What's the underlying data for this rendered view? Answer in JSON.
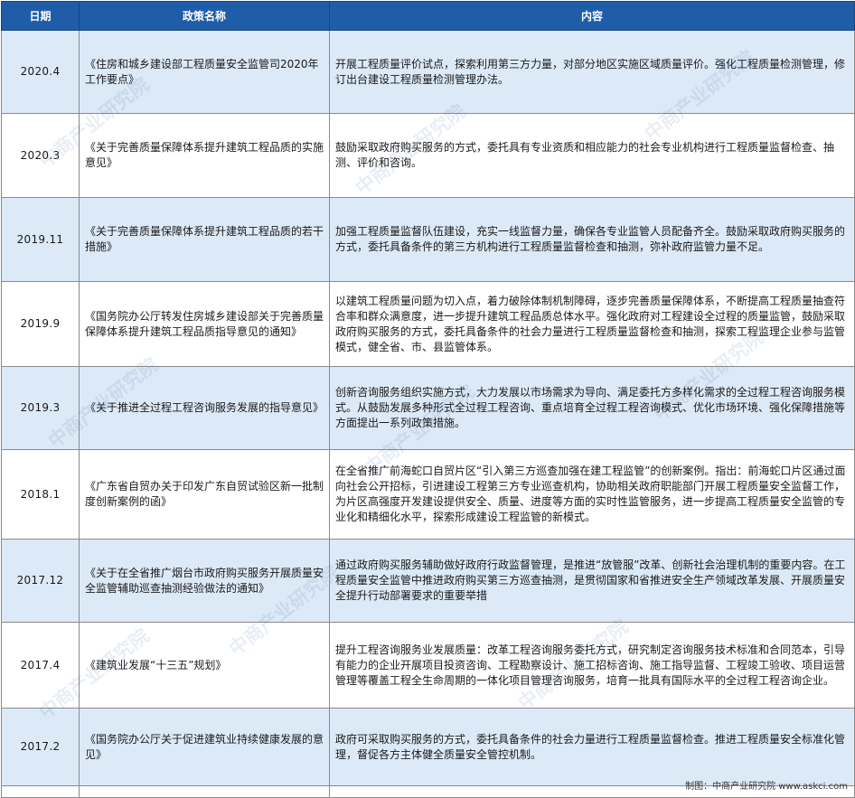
{
  "table": {
    "headers": {
      "date": "日期",
      "name": "政策名称",
      "content": "内容"
    },
    "rows": [
      {
        "date": "2020.4",
        "name": "《住房和城乡建设部工程质量安全监管司2020年工作要点》",
        "content": "开展工程质量评价试点，探索利用第三方力量，对部分地区实施区域质量评价。强化工程质量检测管理，修订出台建设工程质量检测管理办法。"
      },
      {
        "date": "2020.3",
        "name": "《关于完善质量保障体系提升建筑工程品质的实施意见》",
        "content": "鼓励采取政府购买服务的方式，委托具有专业资质和相应能力的社会专业机构进行工程质量监督检查、抽测、评价和咨询。"
      },
      {
        "date": "2019.11",
        "name": "《关于完善质量保障体系提升建筑工程品质的若干措施》",
        "content": "加强工程质量监督队伍建设，充实一线监督力量，确保各专业监管人员配备齐全。鼓励采取政府购买服务的方式，委托具备条件的第三方机构进行工程质量监督检查和抽测，弥补政府监管力量不足。"
      },
      {
        "date": "2019.9",
        "name": "《国务院办公厅转发住房城乡建设部关于完善质量保障体系提升建筑工程品质指导意见的通知》",
        "content": "以建筑工程质量问题为切入点，着力破除体制机制障碍，逐步完善质量保障体系，不断提高工程质量抽查符合率和群众满意度，进一步提升建筑工程品质总体水平。强化政府对工程建设全过程的质量监管，鼓励采取政府购买服务的方式，委托具备条件的社会力量进行工程质量监督检查和抽测，探索工程监理企业参与监管模式，健全省、市、县监管体系。"
      },
      {
        "date": "2019.3",
        "name": "《关于推进全过程工程咨询服务发展的指导意见》",
        "content": "创新咨询服务组织实施方式，大力发展以市场需求为导向、满足委托方多样化需求的全过程工程咨询服务模式。从鼓励发展多种形式全过程工程咨询、重点培育全过程工程咨询模式、优化市场环境、强化保障措施等方面提出一系列政策措施。"
      },
      {
        "date": "2018.1",
        "name": "《广东省自贸办关于印发广东自贸试验区新一批制度创新案例的函》",
        "content": "在全省推广前海蛇口自贸片区“引入第三方巡查加强在建工程监管”的创新案例。指出：前海蛇口片区通过面向社会公开招标，引进建设工程第三方专业巡查机构，协助相关政府职能部门开展工程质量安全监督工作，为片区高强度开发建设提供安全、质量、进度等方面的实时性监管服务，进一步提高工程质量安全监管的专业化和精细化水平，探索形成建设工程监管的新模式。"
      },
      {
        "date": "2017.12",
        "name": "《关于在全省推广烟台市政府购买服务开展质量安全监管辅助巡查抽测经验做法的通知》",
        "content": "通过政府购买服务辅助做好政府行政监督管理，是推进“放管服”改革、创新社会治理机制的重要内容。在工程质量安全监管中推进政府购买第三方巡查抽测，是贯彻国家和省推进安全生产领域改革发展、开展质量安全提升行动部署要求的重要举措"
      },
      {
        "date": "2017.4",
        "name": "《建筑业发展“十三五”规划》",
        "content": "提升工程咨询服务业发展质量：改革工程咨询服务委托方式，研究制定咨询服务技术标准和合同范本，引导有能力的企业开展项目投资咨询、工程勘察设计、施工招标咨询、施工指导监督、工程竣工验收、项目运营管理等覆盖工程全生命周期的一体化项目管理咨询服务，培育一批具有国际水平的全过程工程咨询企业。"
      },
      {
        "date": "2017.2",
        "name": "《国务院办公厅关于促进建筑业持续健康发展的意见》",
        "content": "政府可采取购买服务的方式，委托具备条件的社会力量进行工程质量监督检查。推进工程质量安全标准化管理，督促各方主体健全质量安全管控机制。"
      }
    ]
  },
  "footer": {
    "credit": "制图：中商产业研究院 www.askci.com"
  },
  "watermark": {
    "text": "中商产业研究院"
  },
  "colors": {
    "header_bg": "#1f5da8",
    "stripe_bg": "#dce9f7",
    "border": "#8a8a8a"
  }
}
